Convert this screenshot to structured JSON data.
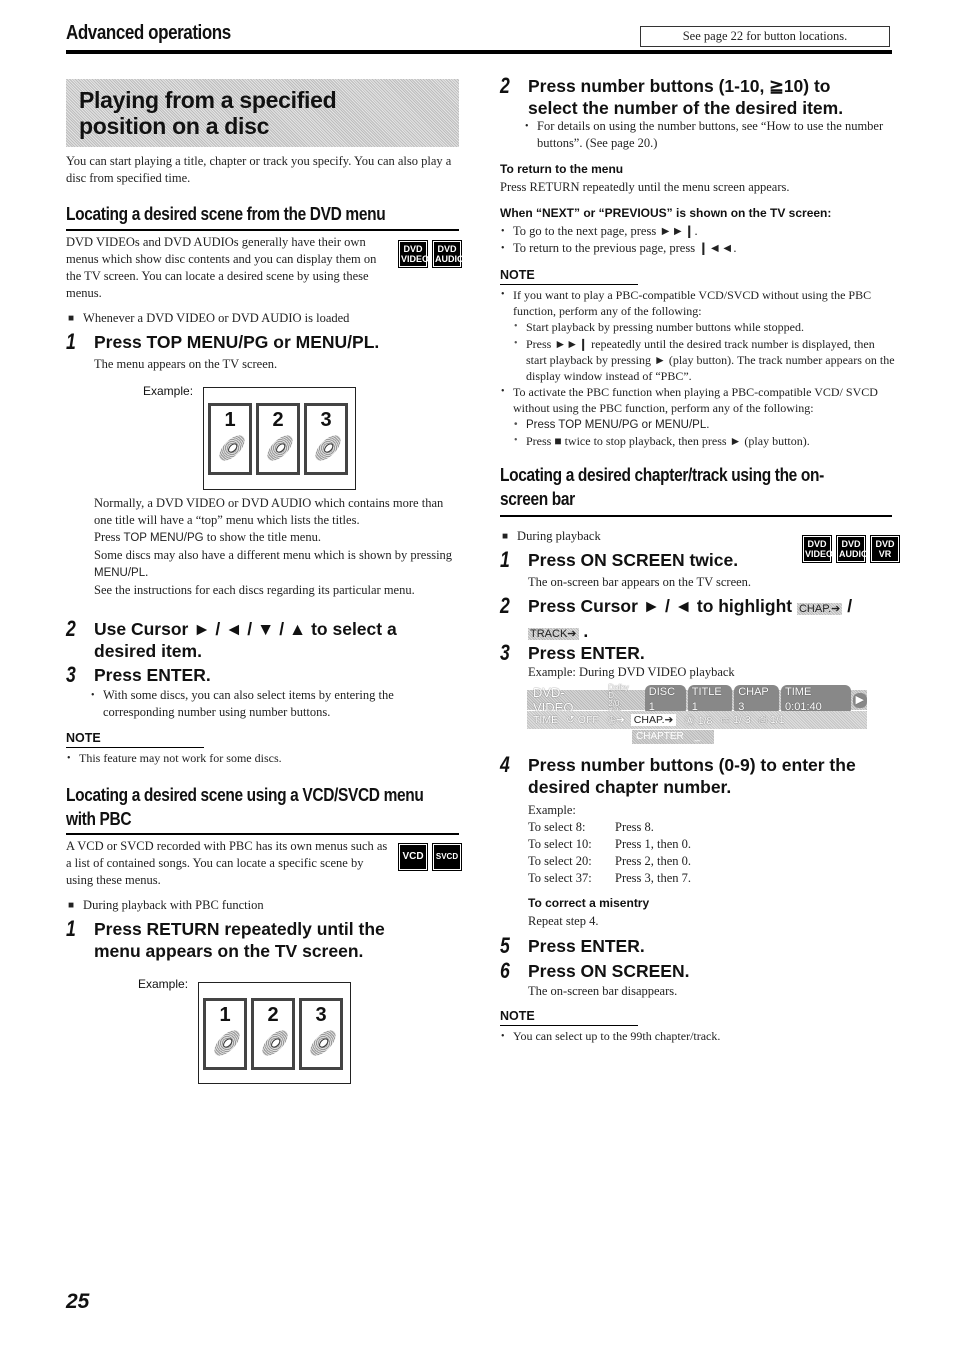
{
  "header": {
    "section_title": "Advanced operations",
    "button_locations_note": "See page 22 for button locations."
  },
  "banner": {
    "line1": "Playing from a specified",
    "line2": "position on a disc"
  },
  "intro": "You can start playing a title, chapter or track you specify. You can also play a disc from specified time.",
  "dvd_menu_section": {
    "title": "Locating a desired scene from the DVD menu",
    "description": "DVD VIDEOs and DVD AUDIOs generally have their own menus which show disc contents and you can display them on the TV screen. You can locate a desired scene by using these menus.",
    "badges": [
      {
        "line1": "DVD",
        "line2": "VIDEO"
      },
      {
        "line1": "DVD",
        "line2": "AUDIO"
      }
    ],
    "condition": "Whenever a DVD VIDEO or DVD AUDIO is loaded",
    "step1": {
      "num": "1",
      "text": "Press TOP MENU/PG or MENU/PL."
    },
    "step1_sub": "The menu appears on the TV screen.",
    "example_label": "Example:",
    "menu_items": [
      "1",
      "2",
      "3"
    ],
    "para1": "Normally, a DVD VIDEO or DVD AUDIO which contains more than one title will have a “top” menu which lists the titles.",
    "para2_btn": "TOP MENU/PG",
    "para2_rest": " to show the title menu.",
    "para2_pre": "Press ",
    "para3_pre": "Some discs may also have a different menu which is shown by pressing ",
    "para3_btn": "MENU/PL",
    "para3_post": ".",
    "para4": "See the instructions for each discs regarding its particular menu.",
    "step2": {
      "num": "2",
      "text_line1": "Use Cursor ► / ◄ / ▼ / ▲ to select a",
      "text_line2": "desired item."
    },
    "step3": {
      "num": "3",
      "text": "Press ENTER."
    },
    "step3_bullet": "With some discs, you can also select items by entering the corresponding number using number buttons.",
    "note_heading": "NOTE",
    "note": "This feature may not work for some discs."
  },
  "vcd_section": {
    "title_line1": "Locating a desired scene using a VCD/SVCD menu",
    "title_line2": "with PBC",
    "description": "A VCD or SVCD recorded with PBC has its own menus such as a list of contained songs. You can locate a specific scene by using these menus.",
    "badges": [
      "VCD",
      "SVCD"
    ],
    "condition": "During playback with PBC function",
    "step1": {
      "num": "1",
      "text_line1": "Press RETURN repeatedly until the",
      "text_line2": "menu appears on the TV screen."
    },
    "example_label": "Example:",
    "menu_items": [
      "1",
      "2",
      "3"
    ]
  },
  "right_col": {
    "step2": {
      "num": "2",
      "text_line1": "Press number buttons (1-10, ≧10) to",
      "text_line2": "select the number of the desired item."
    },
    "step2_bullet": "For details on using the number buttons, see “How to use the number buttons”. (See page 20.)",
    "return_heading": "To return to the menu",
    "return_text": "Press RETURN repeatedly until the menu screen appears.",
    "next_prev_heading": "When “NEXT” or “PREVIOUS” is shown on the TV screen:",
    "next_prev_items": [
      "To go to the next page, press ►►❙.",
      "To return to the previous page, press ❙◄◄."
    ],
    "note_heading": "NOTE",
    "note_item1": "If you want to play a PBC-compatible VCD/SVCD without using the PBC function, perform any of the following:",
    "note_item1_subs": [
      "Start playback by pressing number buttons while stopped.",
      "Press ►►❙ repeatedly until the desired track number is displayed, then start playback by pressing ► (play button). The track number appears on the display window instead of “PBC”."
    ],
    "note_item2": "To activate the PBC function when playing a PBC-compatible VCD/ SVCD without using the PBC function, perform any of the following:",
    "note_item2_sub1_btn": "Press TOP MENU/PG or MENU/PL.",
    "note_item2_sub2": "Press ■ twice to stop playback, then press ► (play button)."
  },
  "onscreen_section": {
    "title_line1": "Locating a desired chapter/track using the on-",
    "title_line2": "screen bar",
    "condition": "During playback",
    "badges": [
      {
        "line1": "DVD",
        "line2": "VIDEO"
      },
      {
        "line1": "DVD",
        "line2": "AUDIO"
      },
      {
        "line1": "DVD",
        "line2": "VR"
      }
    ],
    "step1": {
      "num": "1",
      "text": "Press ON SCREEN twice."
    },
    "step1_sub": "The on-screen bar appears on the TV screen.",
    "step2": {
      "num": "2",
      "text": "Press Cursor ► / ◄ to highlight",
      "chip1": "CHAP.➔",
      "slash": " /",
      "chip2": "TRACK➔",
      "end": " ."
    },
    "step3": {
      "num": "3",
      "text": "Press ENTER."
    },
    "step3_sub": "Example: During DVD VIDEO playback",
    "osd": {
      "format": "DVD-VIDEO",
      "audio_line1": "Dolby D",
      "audio_line2": "2/0. 0ch",
      "disc": "DISC 1",
      "title": "TITLE  1",
      "chap": "CHAP  3",
      "time": "TIME  0:01:40",
      "row2": {
        "time_label": "TIME",
        "repeat": "↺ OFF",
        "timer": "◷➔",
        "chap_selected": "CHAP.➔",
        "audio": "Ⓐ 1/8",
        "subtitle": "▭ 1/ 3",
        "angle": "⎙ 1/1"
      },
      "input_label": "CHAPTER",
      "input_value": "_"
    },
    "step4": {
      "num": "4",
      "text_line1": "Press number buttons (0-9) to enter the",
      "text_line2": "desired chapter number."
    },
    "example_label": "Example:",
    "examples": [
      {
        "select": "To select 8:",
        "press": "Press 8."
      },
      {
        "select": "To select 10:",
        "press": "Press 1, then 0."
      },
      {
        "select": "To select 20:",
        "press": "Press 2, then 0."
      },
      {
        "select": "To select 37:",
        "press": "Press 3, then 7."
      }
    ],
    "misentry_heading": "To correct a misentry",
    "misentry_text": "Repeat step 4.",
    "step5": {
      "num": "5",
      "text": "Press ENTER."
    },
    "step6": {
      "num": "6",
      "text": "Press ON SCREEN."
    },
    "step6_sub": "The on-screen bar disappears.",
    "note_heading": "NOTE",
    "note": "You can select up to the 99th chapter/track."
  },
  "page_number": "25"
}
